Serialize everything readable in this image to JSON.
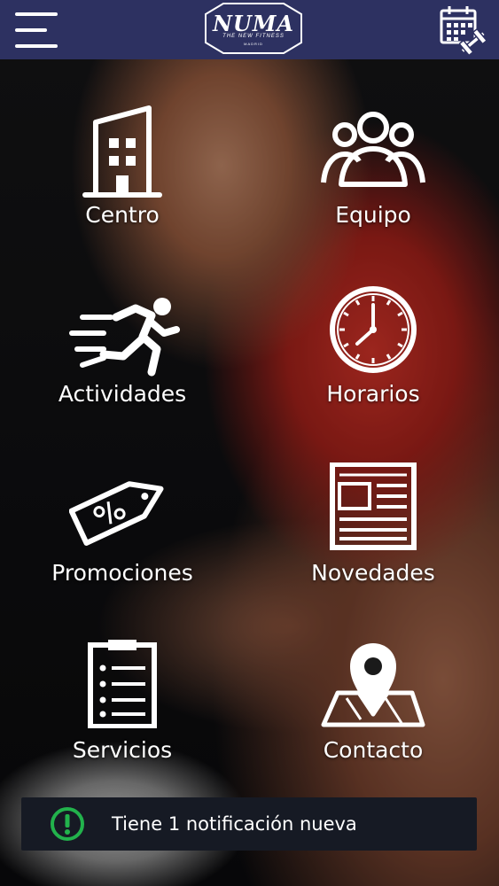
{
  "header": {
    "logo_word": "NUMA",
    "logo_tagline": "THE NEW FITNESS",
    "logo_city": "MADRID"
  },
  "menu": [
    {
      "label": "Centro",
      "icon": "building-icon"
    },
    {
      "label": "Equipo",
      "icon": "team-icon"
    },
    {
      "label": "Actividades",
      "icon": "running-icon"
    },
    {
      "label": "Horarios",
      "icon": "clock-icon"
    },
    {
      "label": "Promociones",
      "icon": "discount-tag-icon"
    },
    {
      "label": "Novedades",
      "icon": "newspaper-icon"
    },
    {
      "label": "Servicios",
      "icon": "clipboard-icon"
    },
    {
      "label": "Contacto",
      "icon": "map-pin-icon"
    }
  ],
  "notification": {
    "text": "Tiene 1 notificación nueva",
    "accent": "#22b24c"
  },
  "colors": {
    "header_bg": "#2d3161",
    "notification_bg": "#161a24"
  }
}
